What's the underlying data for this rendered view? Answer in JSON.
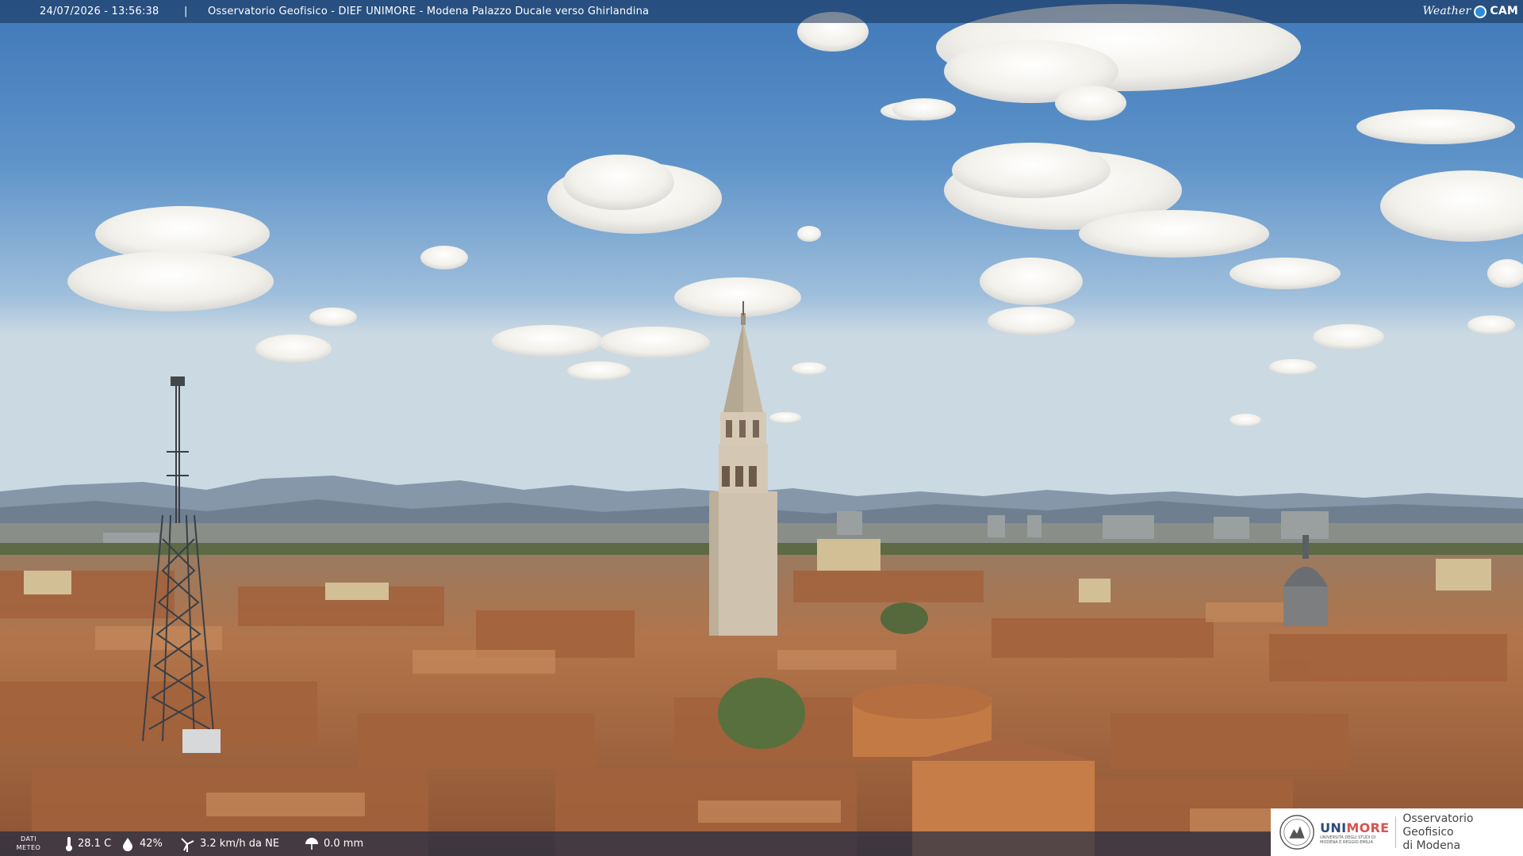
{
  "overlay": {
    "timestamp": "24/07/2026 - 13:56:38",
    "separator": "|",
    "title": "Osservatorio Geofisico - DIEF UNIMORE - Modena Palazzo Ducale verso Ghirlandina"
  },
  "brand": {
    "weather": "Weather",
    "cam": "CAM"
  },
  "meteo": {
    "label_line1": "DATI",
    "label_line2": "METEO",
    "temperature": "28.1 C",
    "humidity": "42%",
    "wind": "3.2 km/h da NE",
    "rain": "0.0 mm"
  },
  "logo": {
    "uni": "UNI",
    "more": "MORE",
    "uni_small": "UNIVERSITÀ DEGLI STUDI DI MODENA E REGGIO EMILIA",
    "obs_line1": "Osservatorio Geofisico",
    "obs_line2": "di Modena"
  },
  "icons": {
    "temperature": "thermometer-icon",
    "humidity": "humidity-icon",
    "wind": "wind-icon",
    "rain": "rain-icon"
  },
  "colors": {
    "sky_top": "#3e76b8",
    "roof": "#b8744a",
    "tower": "#c9bba8",
    "overlay": "#142d50"
  }
}
